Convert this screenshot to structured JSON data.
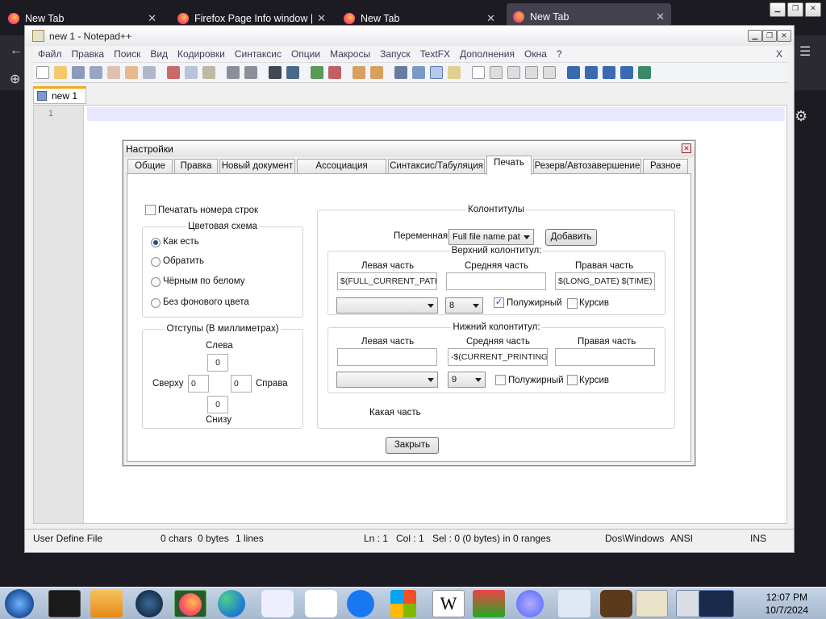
{
  "browser": {
    "tabs": [
      {
        "label": "New Tab",
        "icon": "firefox-icon"
      },
      {
        "label": "Firefox Page Info window | F",
        "icon": "firefox-icon"
      },
      {
        "label": "New Tab",
        "icon": "firefox-icon"
      },
      {
        "label": "New Tab",
        "icon": "firefox-icon"
      }
    ]
  },
  "npp": {
    "title": "new 1 - Notepad++",
    "menu": [
      "Файл",
      "Правка",
      "Поиск",
      "Вид",
      "Кодировки",
      "Синтаксис",
      "Опции",
      "Макросы",
      "Запуск",
      "TextFX",
      "Дополнения",
      "Окна",
      "?"
    ],
    "menu_close": "X",
    "doc_tab": "new 1",
    "line_number": "1",
    "status": {
      "lang": "User Define File",
      "chars": "0 chars",
      "bytes": "0 bytes",
      "lines": "1 lines",
      "ln": "Ln : 1",
      "col": "Col : 1",
      "sel": "Sel : 0 (0 bytes) in 0 ranges",
      "eol": "Dos\\Windows",
      "enc": "ANSI",
      "ins": "INS"
    }
  },
  "dialog": {
    "title": "Настройки",
    "tabs": [
      "Общие",
      "Правка",
      "Новый документ",
      "Ассоциация файлов",
      "Синтаксис/Табуляция",
      "Печать",
      "Резерв/Автозавершение",
      "Разное"
    ],
    "selected_tab": "Печать",
    "print_line_numbers": "Печатать номера строк",
    "color_scheme": {
      "legend": "Цветовая схема",
      "options": [
        "Как есть",
        "Обратить",
        "Чёрным по белому",
        "Без фонового цвета"
      ],
      "selected": "Как есть"
    },
    "margins": {
      "legend": "Отступы (В миллиметрах)",
      "left_label": "Слева",
      "left": "0",
      "top_label": "Сверху",
      "top": "0",
      "right_label": "Справа",
      "right": "0",
      "bottom_label": "Снизу",
      "bottom": "0"
    },
    "headers": {
      "legend": "Колонтитулы",
      "variable_label": "Переменная:",
      "variable_value": "Full file name pat",
      "add_button": "Добавить",
      "header": {
        "legend": "Верхний колонтитул:",
        "left_label": "Левая часть",
        "middle_label": "Средняя часть",
        "right_label": "Правая часть",
        "left": "$(FULL_CURRENT_PATH)",
        "middle": "",
        "right": "$(LONG_DATE) $(TIME)",
        "font_size": "8",
        "bold_label": "Полужирный",
        "bold": true,
        "italic_label": "Курсив",
        "italic": false
      },
      "footer": {
        "legend": "Нижний колонтитул:",
        "left_label": "Левая часть",
        "middle_label": "Средняя часть",
        "right_label": "Правая часть",
        "left": "",
        "middle": "-$(CURRENT_PRINTING_PAGE)-",
        "right": "",
        "font_size": "9",
        "bold_label": "Полужирный",
        "bold": false,
        "italic_label": "Курсив",
        "italic": false
      },
      "which_part": "Какая часть"
    },
    "close_button": "Закрыть"
  },
  "taskbar": {
    "time": "12:07 PM",
    "date": "10/7/2024",
    "icons": [
      "start-orb-icon",
      "terminal-icon",
      "media-player-icon",
      "network-globe-icon",
      "firefox-icon",
      "edge-icon",
      "video-icon",
      "amazon-icon",
      "facebook-icon",
      "microsoft-icon",
      "wikipedia-icon",
      "store-icon",
      "copilot-icon",
      "bank-icon",
      "ups-icon",
      "notepad-icon",
      "notepad-plus-icon",
      "remote-desktop-icon"
    ]
  }
}
